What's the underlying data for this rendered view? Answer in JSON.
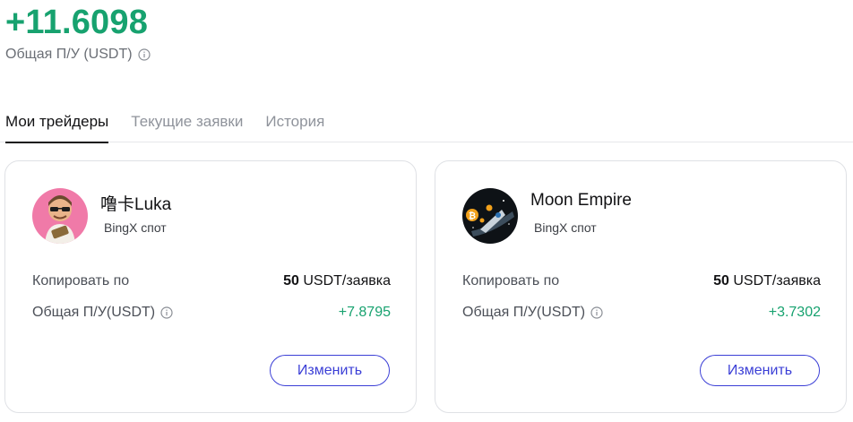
{
  "summary": {
    "total_pnl": "+11.6098",
    "total_label": "Общая П/У (USDT)"
  },
  "tabs": [
    {
      "label": "Мои трейдеры",
      "active": true
    },
    {
      "label": "Текущие заявки",
      "active": false
    },
    {
      "label": "История",
      "active": false
    }
  ],
  "traders": [
    {
      "name": "噜卡Luka",
      "type": "BingX спот",
      "copy_label": "Копировать по",
      "copy_amount": "50",
      "copy_unit": "USDT/заявка",
      "pnl_label": "Общая П/У(USDT)",
      "pnl_value": "+7.8795",
      "edit_label": "Изменить"
    },
    {
      "name": "Moon Empire",
      "type": "BingX спот",
      "copy_label": "Копировать по",
      "copy_amount": "50",
      "copy_unit": "USDT/заявка",
      "pnl_label": "Общая П/У(USDT)",
      "pnl_value": "+3.7302",
      "edit_label": "Изменить"
    }
  ],
  "colors": {
    "positive": "#17a26f",
    "accent": "#3b3fd6"
  }
}
